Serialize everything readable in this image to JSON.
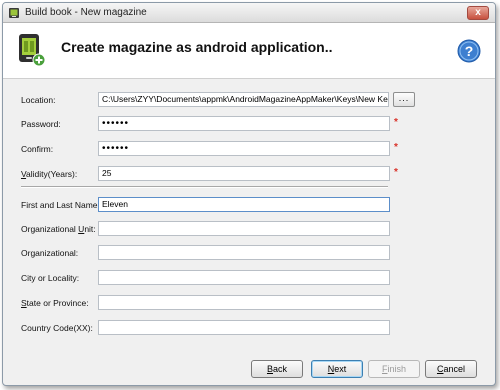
{
  "window": {
    "title": "Build book - New magazine",
    "close_glyph": "x"
  },
  "header": {
    "title": "Create magazine as android application..",
    "icon": "android-book-icon",
    "help_glyph": "?"
  },
  "form": {
    "location": {
      "label": "Location:",
      "value": "C:\\Users\\ZYY\\Documents\\appmk\\AndroidMagazineAppMaker\\Keys\\New KeyStore.k",
      "browse_label": "..."
    },
    "password": {
      "label": "Password:",
      "value": "••••••",
      "required": "*"
    },
    "confirm": {
      "label": "Confirm:",
      "value": "••••••",
      "required": "*"
    },
    "validity": {
      "label_key": "V",
      "label_rest": "alidity(Years):",
      "value": "25",
      "required": "*"
    },
    "first_last_name": {
      "label": "First and Last Name:",
      "value": "Eleven"
    },
    "org_unit": {
      "label_pre": "Organizational ",
      "label_key": "U",
      "label_post": "nit:",
      "value": ""
    },
    "organizational": {
      "label": "Organizational:",
      "value": ""
    },
    "city": {
      "label": "City or Locality:",
      "value": ""
    },
    "state": {
      "label_key": "S",
      "label_rest": "tate or Province:",
      "value": ""
    },
    "country": {
      "label": "Country Code(XX):",
      "value": ""
    }
  },
  "footer": {
    "back": {
      "key": "B",
      "rest": "ack"
    },
    "next": {
      "key": "N",
      "rest": "ext"
    },
    "finish": {
      "key": "F",
      "rest": "inish"
    },
    "cancel": {
      "key": "C",
      "rest": "ancel"
    }
  }
}
